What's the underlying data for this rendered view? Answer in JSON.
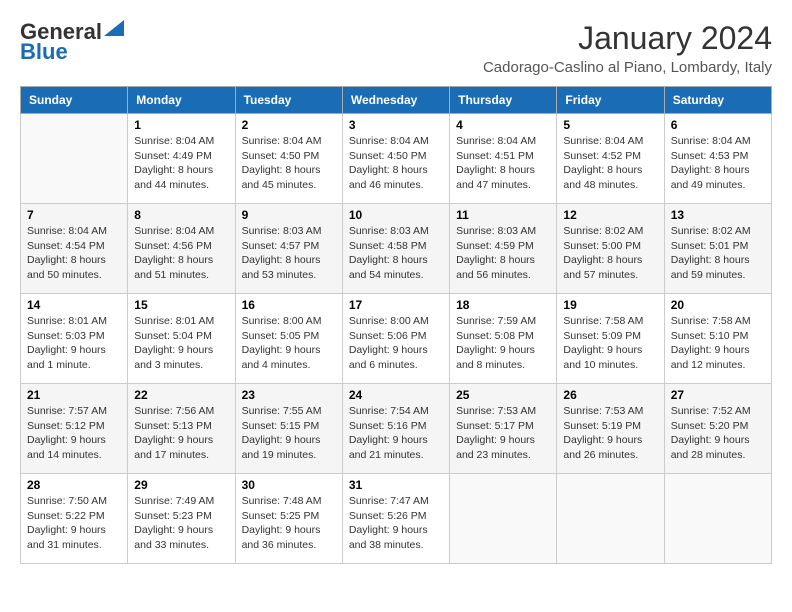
{
  "logo": {
    "general": "General",
    "blue": "Blue"
  },
  "title": "January 2024",
  "subtitle": "Cadorago-Caslino al Piano, Lombardy, Italy",
  "headers": [
    "Sunday",
    "Monday",
    "Tuesday",
    "Wednesday",
    "Thursday",
    "Friday",
    "Saturday"
  ],
  "weeks": [
    [
      {
        "day": "",
        "info": ""
      },
      {
        "day": "1",
        "info": "Sunrise: 8:04 AM\nSunset: 4:49 PM\nDaylight: 8 hours\nand 44 minutes."
      },
      {
        "day": "2",
        "info": "Sunrise: 8:04 AM\nSunset: 4:50 PM\nDaylight: 8 hours\nand 45 minutes."
      },
      {
        "day": "3",
        "info": "Sunrise: 8:04 AM\nSunset: 4:50 PM\nDaylight: 8 hours\nand 46 minutes."
      },
      {
        "day": "4",
        "info": "Sunrise: 8:04 AM\nSunset: 4:51 PM\nDaylight: 8 hours\nand 47 minutes."
      },
      {
        "day": "5",
        "info": "Sunrise: 8:04 AM\nSunset: 4:52 PM\nDaylight: 8 hours\nand 48 minutes."
      },
      {
        "day": "6",
        "info": "Sunrise: 8:04 AM\nSunset: 4:53 PM\nDaylight: 8 hours\nand 49 minutes."
      }
    ],
    [
      {
        "day": "7",
        "info": "Sunrise: 8:04 AM\nSunset: 4:54 PM\nDaylight: 8 hours\nand 50 minutes."
      },
      {
        "day": "8",
        "info": "Sunrise: 8:04 AM\nSunset: 4:56 PM\nDaylight: 8 hours\nand 51 minutes."
      },
      {
        "day": "9",
        "info": "Sunrise: 8:03 AM\nSunset: 4:57 PM\nDaylight: 8 hours\nand 53 minutes."
      },
      {
        "day": "10",
        "info": "Sunrise: 8:03 AM\nSunset: 4:58 PM\nDaylight: 8 hours\nand 54 minutes."
      },
      {
        "day": "11",
        "info": "Sunrise: 8:03 AM\nSunset: 4:59 PM\nDaylight: 8 hours\nand 56 minutes."
      },
      {
        "day": "12",
        "info": "Sunrise: 8:02 AM\nSunset: 5:00 PM\nDaylight: 8 hours\nand 57 minutes."
      },
      {
        "day": "13",
        "info": "Sunrise: 8:02 AM\nSunset: 5:01 PM\nDaylight: 8 hours\nand 59 minutes."
      }
    ],
    [
      {
        "day": "14",
        "info": "Sunrise: 8:01 AM\nSunset: 5:03 PM\nDaylight: 9 hours\nand 1 minute."
      },
      {
        "day": "15",
        "info": "Sunrise: 8:01 AM\nSunset: 5:04 PM\nDaylight: 9 hours\nand 3 minutes."
      },
      {
        "day": "16",
        "info": "Sunrise: 8:00 AM\nSunset: 5:05 PM\nDaylight: 9 hours\nand 4 minutes."
      },
      {
        "day": "17",
        "info": "Sunrise: 8:00 AM\nSunset: 5:06 PM\nDaylight: 9 hours\nand 6 minutes."
      },
      {
        "day": "18",
        "info": "Sunrise: 7:59 AM\nSunset: 5:08 PM\nDaylight: 9 hours\nand 8 minutes."
      },
      {
        "day": "19",
        "info": "Sunrise: 7:58 AM\nSunset: 5:09 PM\nDaylight: 9 hours\nand 10 minutes."
      },
      {
        "day": "20",
        "info": "Sunrise: 7:58 AM\nSunset: 5:10 PM\nDaylight: 9 hours\nand 12 minutes."
      }
    ],
    [
      {
        "day": "21",
        "info": "Sunrise: 7:57 AM\nSunset: 5:12 PM\nDaylight: 9 hours\nand 14 minutes."
      },
      {
        "day": "22",
        "info": "Sunrise: 7:56 AM\nSunset: 5:13 PM\nDaylight: 9 hours\nand 17 minutes."
      },
      {
        "day": "23",
        "info": "Sunrise: 7:55 AM\nSunset: 5:15 PM\nDaylight: 9 hours\nand 19 minutes."
      },
      {
        "day": "24",
        "info": "Sunrise: 7:54 AM\nSunset: 5:16 PM\nDaylight: 9 hours\nand 21 minutes."
      },
      {
        "day": "25",
        "info": "Sunrise: 7:53 AM\nSunset: 5:17 PM\nDaylight: 9 hours\nand 23 minutes."
      },
      {
        "day": "26",
        "info": "Sunrise: 7:53 AM\nSunset: 5:19 PM\nDaylight: 9 hours\nand 26 minutes."
      },
      {
        "day": "27",
        "info": "Sunrise: 7:52 AM\nSunset: 5:20 PM\nDaylight: 9 hours\nand 28 minutes."
      }
    ],
    [
      {
        "day": "28",
        "info": "Sunrise: 7:50 AM\nSunset: 5:22 PM\nDaylight: 9 hours\nand 31 minutes."
      },
      {
        "day": "29",
        "info": "Sunrise: 7:49 AM\nSunset: 5:23 PM\nDaylight: 9 hours\nand 33 minutes."
      },
      {
        "day": "30",
        "info": "Sunrise: 7:48 AM\nSunset: 5:25 PM\nDaylight: 9 hours\nand 36 minutes."
      },
      {
        "day": "31",
        "info": "Sunrise: 7:47 AM\nSunset: 5:26 PM\nDaylight: 9 hours\nand 38 minutes."
      },
      {
        "day": "",
        "info": ""
      },
      {
        "day": "",
        "info": ""
      },
      {
        "day": "",
        "info": ""
      }
    ]
  ]
}
